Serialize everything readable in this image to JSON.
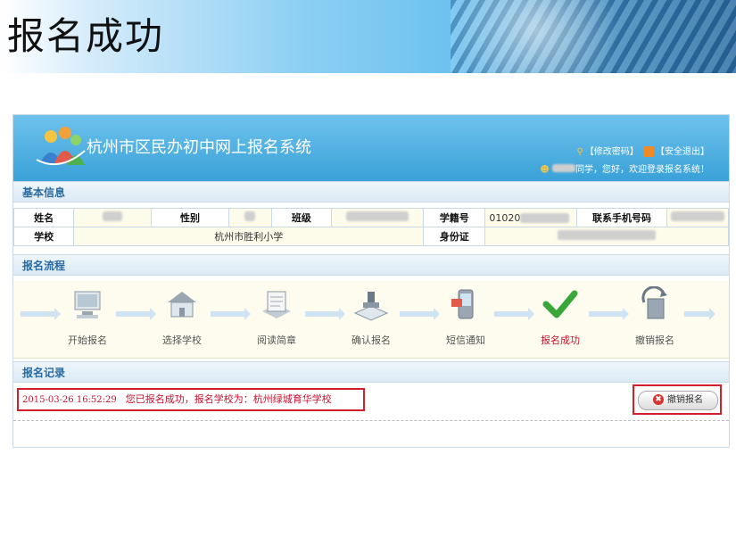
{
  "slide": {
    "title": "报名成功"
  },
  "app": {
    "title": "杭州市区民办初中网上报名系统",
    "links": {
      "change_password": "【修改密码】",
      "logout": "【安全退出】"
    },
    "user_greeting": "同学，您好，欢迎登录报名系统！"
  },
  "sections": {
    "basic_info": "基本信息",
    "flow": "报名流程",
    "records": "报名记录"
  },
  "basic_info": {
    "name_label": "姓名",
    "gender_label": "性别",
    "class_label": "班级",
    "student_id_label": "学籍号",
    "student_id_value": "01020",
    "phone_label": "联系手机号码",
    "school_label": "学校",
    "school_value": "杭州市胜利小学",
    "id_card_label": "身份证"
  },
  "flow_steps": [
    {
      "label": "开始报名",
      "icon": "computer-icon"
    },
    {
      "label": "选择学校",
      "icon": "school-icon"
    },
    {
      "label": "阅读简章",
      "icon": "document-icon"
    },
    {
      "label": "确认报名",
      "icon": "stamp-icon"
    },
    {
      "label": "短信通知",
      "icon": "phone-icon"
    },
    {
      "label": "报名成功",
      "icon": "checkmark-icon",
      "active": true
    },
    {
      "label": "撤销报名",
      "icon": "recycle-icon"
    }
  ],
  "record": {
    "timestamp": "2015-03-26 16:52:29",
    "message": "您已报名成功，报名学校为：杭州绿城育华学校",
    "cancel_button": "撤销报名"
  },
  "colors": {
    "accent": "#39a1d8",
    "highlight": "#d21f2a",
    "active_step": "#c8102e"
  }
}
